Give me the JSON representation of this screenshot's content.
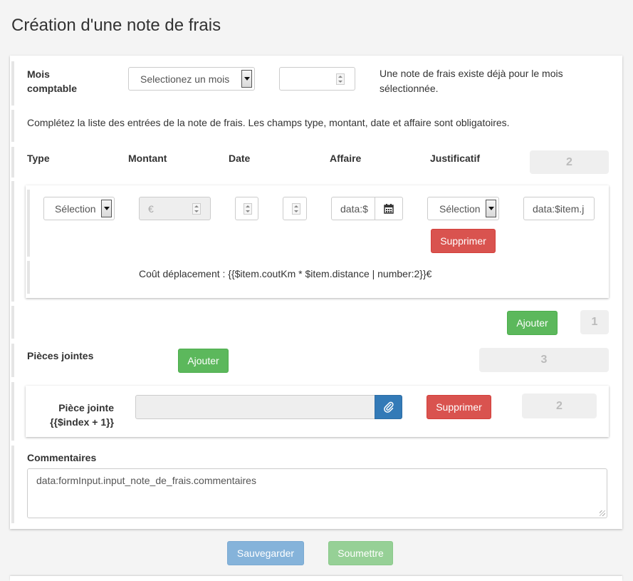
{
  "page": {
    "title": "Création d'une note de frais"
  },
  "month": {
    "label": "Mois comptable",
    "select_value": "Selectionez un mois",
    "year_value": "",
    "warning": "Une note de frais existe déjà pour le mois sélectionnée."
  },
  "instructions": "Complétez la liste des entrées de la note de frais. Les champs type, montant, date et affaire sont obligatoires.",
  "columns": {
    "type": "Type",
    "montant": "Montant",
    "date": "Date",
    "affaire": "Affaire",
    "justificatif": "Justificatif",
    "count": "2"
  },
  "entry": {
    "type_value": "Sélection",
    "montant_placeholder": "€",
    "affaire_value": "data:$",
    "justificatif_value": "Sélection",
    "justificatif_text": "data:$item.j",
    "delete_label": "Supprimer",
    "cost_text": "Coût déplacement : {{$item.coutKm * $item.distance | number:2}}€"
  },
  "entries_footer": {
    "add_label": "Ajouter",
    "count": "1"
  },
  "attachments": {
    "label": "Pièces jointes",
    "add_label": "Ajouter",
    "count": "3",
    "item": {
      "label": "Pièce jointe {{$index + 1}}",
      "file_value": "",
      "delete_label": "Supprimer",
      "count": "2"
    }
  },
  "comments": {
    "label": "Commentaires",
    "value": "data:formInput.input_note_de_frais.commentaires"
  },
  "footer": {
    "save_label": "Sauvegarder",
    "submit_label": "Soumettre"
  },
  "colors": {
    "green": "#5cb85c",
    "red": "#d9534f",
    "blue": "#337ab7"
  }
}
